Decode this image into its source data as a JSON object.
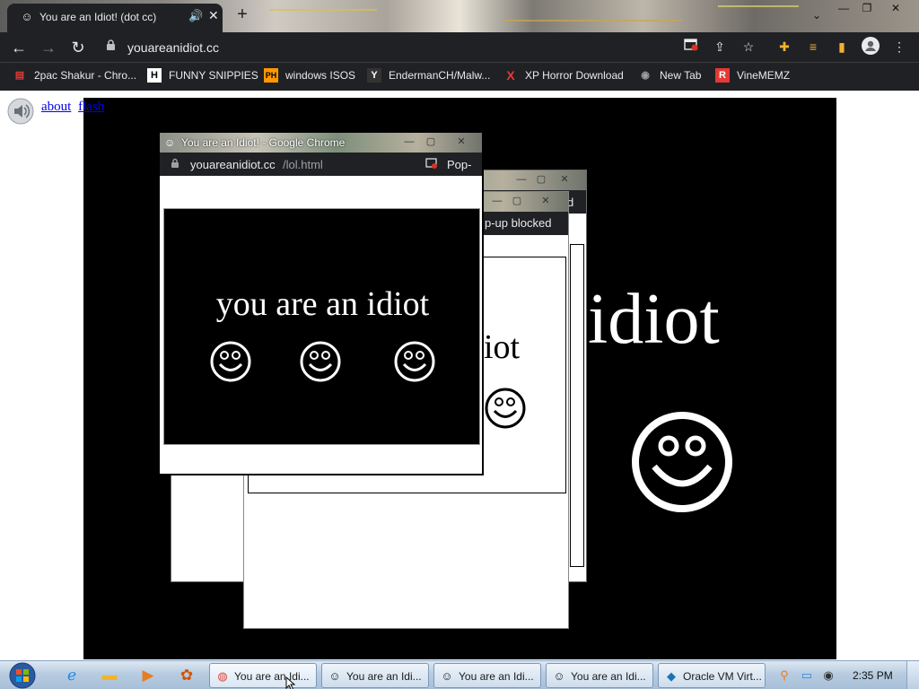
{
  "browser": {
    "tab": {
      "title": "You are an Idiot! (dot cc)",
      "favicon": "smiley-icon",
      "audio_icon": "🔊",
      "close": "✕"
    },
    "new_tab": "+",
    "window_controls": {
      "minimize": "—",
      "restore": "❐",
      "close": "✕"
    },
    "nav": {
      "back": "←",
      "forward": "→",
      "reload": "↻"
    },
    "address": {
      "lock": "🔒",
      "url": "youareanidiot.cc"
    },
    "toolbar_icons": [
      "popup-blocked-icon",
      "share-icon",
      "star-icon",
      "extensions-icon",
      "media-icon",
      "side-panel-icon",
      "profile-icon",
      "menu-icon"
    ],
    "bookmarks": [
      {
        "label": "2pac Shakur - Chro...",
        "icon": "▤",
        "color": "#e53935"
      },
      {
        "label": "FUNNY SNIPPIES",
        "icon": "H",
        "color": "#ffffff"
      },
      {
        "label": "windows ISOS",
        "icon": "PH",
        "color": "#ff9800"
      },
      {
        "label": "EndermanCH/Malw...",
        "icon": "Y",
        "color": "#ffffff"
      },
      {
        "label": "XP Horror Download",
        "icon": "X",
        "color": "#e53935"
      },
      {
        "label": "New Tab",
        "icon": "◉",
        "color": "#9e9e9e"
      },
      {
        "label": "VineMEMZ",
        "icon": "R",
        "color": "#e53935"
      }
    ]
  },
  "page": {
    "links": {
      "about": "about",
      "flash": "flash"
    },
    "big_text": "idiot"
  },
  "popups": {
    "front": {
      "title": "You are an Idiot! - Google Chrome",
      "url_host": "youareanidiot.cc",
      "url_path": "/lol.html",
      "popup_label": "Pop-",
      "content_text": "you are an idiot"
    },
    "middle": {
      "blocked_label": "p-up blocked",
      "content_text": "iot"
    },
    "back": {
      "corner_text": "d"
    }
  },
  "taskbar": {
    "start": "start-orb",
    "pinned": [
      "internet-explorer-icon",
      "explorer-folder-icon",
      "media-player-icon",
      "photos-icon"
    ],
    "tasks": [
      {
        "label": "You are an Idi...",
        "icon": "chrome-icon",
        "glyph": "◍"
      },
      {
        "label": "You are an Idi...",
        "icon": "smiley-icon",
        "glyph": "☺"
      },
      {
        "label": "You are an Idi...",
        "icon": "smiley-icon",
        "glyph": "☺"
      },
      {
        "label": "You are an Idi...",
        "icon": "smiley-icon",
        "glyph": "☺"
      },
      {
        "label": "Oracle VM Virt...",
        "icon": "virtualbox-icon",
        "glyph": "◆"
      }
    ],
    "clock": "2:35 PM"
  },
  "colors": {
    "chrome_dark": "#202124",
    "page_black": "#000000",
    "link_blue": "#0000ee"
  }
}
